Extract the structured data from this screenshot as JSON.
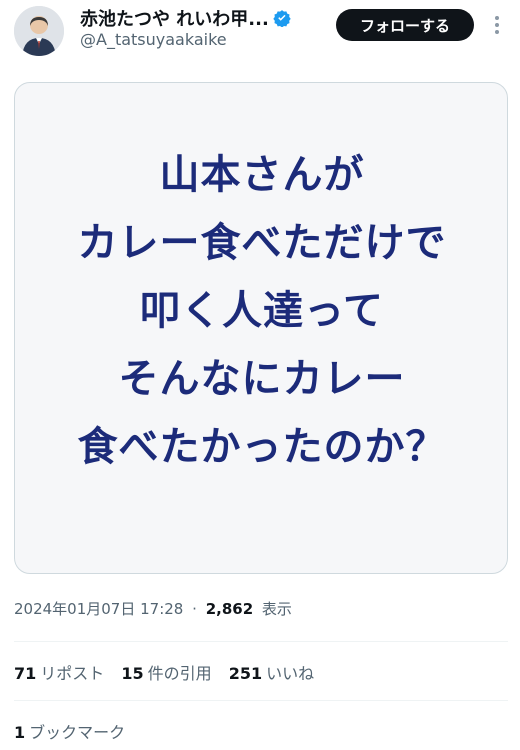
{
  "author": {
    "display_name": "赤池たつや れいわ甲...",
    "handle": "@A_tatsuyaakaike",
    "avatar_icon": "person-avatar",
    "verified_icon": "verified-badge-icon",
    "verified_color": "#1d9bf0"
  },
  "follow_button": {
    "label": "フォローする"
  },
  "more_menu": {
    "icon": "more-vertical-icon"
  },
  "image_text": {
    "lines": [
      "山本さんが",
      "カレー食べただけで",
      "叩く人達って",
      "そんなにカレー",
      "食べたかったのか？"
    ],
    "color": "#1c2b7a"
  },
  "meta": {
    "timestamp": "2024年01月07日 17:28",
    "separator": "·",
    "views_count": "2,862",
    "views_label": "表示"
  },
  "stats": {
    "reposts_count": "71",
    "reposts_label": "リポスト",
    "quotes_count": "15",
    "quotes_label": "件の引用",
    "likes_count": "251",
    "likes_label": "いいね"
  },
  "bookmarks": {
    "count": "1",
    "label": "ブックマーク"
  }
}
